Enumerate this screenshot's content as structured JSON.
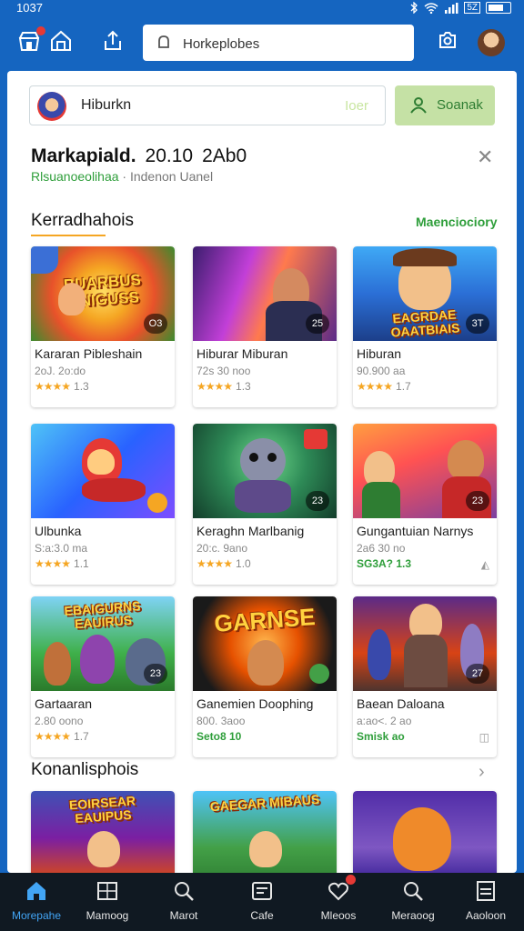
{
  "status": {
    "time": "1037",
    "battery": "5Z"
  },
  "search": {
    "value": "Horkeplobes"
  },
  "input_row": {
    "name": "Hiburkn",
    "hint": "Ioer"
  },
  "search_button": "Soanak",
  "info": {
    "title": "Markapiald.",
    "num1": "20.10",
    "num2": "2Ab0",
    "subtitle_green": "Rlsuanoeolihaa",
    "subtitle_rest": "· Indenon Uanel"
  },
  "section1": {
    "title": "Kerradhahois",
    "more": "Maenciociory"
  },
  "section2": {
    "title": "Konanlisphois"
  },
  "cards": [
    {
      "name": "Kararan Pibleshain",
      "meta": "2oJ. 2o:do",
      "rating": "1.3",
      "badge": "O3",
      "logo": "BUARBUS GNIGUSS"
    },
    {
      "name": "Hiburar Miburan",
      "meta": "72s 30 noo",
      "rating": "1.3",
      "badge": "25",
      "logo": ""
    },
    {
      "name": "Hiburan",
      "meta": "90.900 aa",
      "rating": "1.7",
      "badge": "3T",
      "logo": "EAGRDAE OAATBIAIS"
    },
    {
      "name": "Ulbunka",
      "meta": "S:a:3.0 ma",
      "rating": "1.1",
      "badge": "",
      "logo": ""
    },
    {
      "name": "Keraghn Marlbanig",
      "meta": "20:c. 9ano",
      "rating": "1.0",
      "badge": "23",
      "logo": ""
    },
    {
      "name": "Gungantuian Narnys",
      "meta": "2a6 30 no",
      "rating_green": "SG3A? 1.3",
      "badge": "23",
      "logo": ""
    },
    {
      "name": "Gartaaran",
      "meta": "2.80 oono",
      "rating": "1.7",
      "badge": "23",
      "logo": "EBAIGURNS EAUIRUS"
    },
    {
      "name": "Ganemien Doophing",
      "meta": "800. 3aoo",
      "rating_green": "Seto8 10",
      "badge": "",
      "logo": "GARNSE"
    },
    {
      "name": "Baean Daloana",
      "meta": "a:ao<. 2 ao",
      "rating_green": "Smisk ao",
      "badge": "27",
      "logo": ""
    },
    {
      "name": "",
      "meta": "",
      "rating": "",
      "badge": "",
      "logo": "EOIRSEAR EAUIPUS"
    },
    {
      "name": "",
      "meta": "",
      "rating": "",
      "badge": "",
      "logo": "GAEGAR MIBAUS"
    },
    {
      "name": "",
      "meta": "",
      "rating": "",
      "badge": "",
      "logo": ""
    }
  ],
  "nav": [
    {
      "label": "Morepahe",
      "icon": "home-icon"
    },
    {
      "label": "Mamoog",
      "icon": "gallery-icon"
    },
    {
      "label": "Marot",
      "icon": "search-icon"
    },
    {
      "label": "Cafe",
      "icon": "chat-icon"
    },
    {
      "label": "Mleoos",
      "icon": "heart-icon"
    },
    {
      "label": "Meraoog",
      "icon": "search-icon"
    },
    {
      "label": "Aaoloon",
      "icon": "list-icon"
    }
  ],
  "colors": {
    "primary": "#1565c0",
    "accent": "#2e9e3a",
    "nav_bg": "#101922",
    "active": "#42a5f5",
    "star": "#f5a623"
  }
}
